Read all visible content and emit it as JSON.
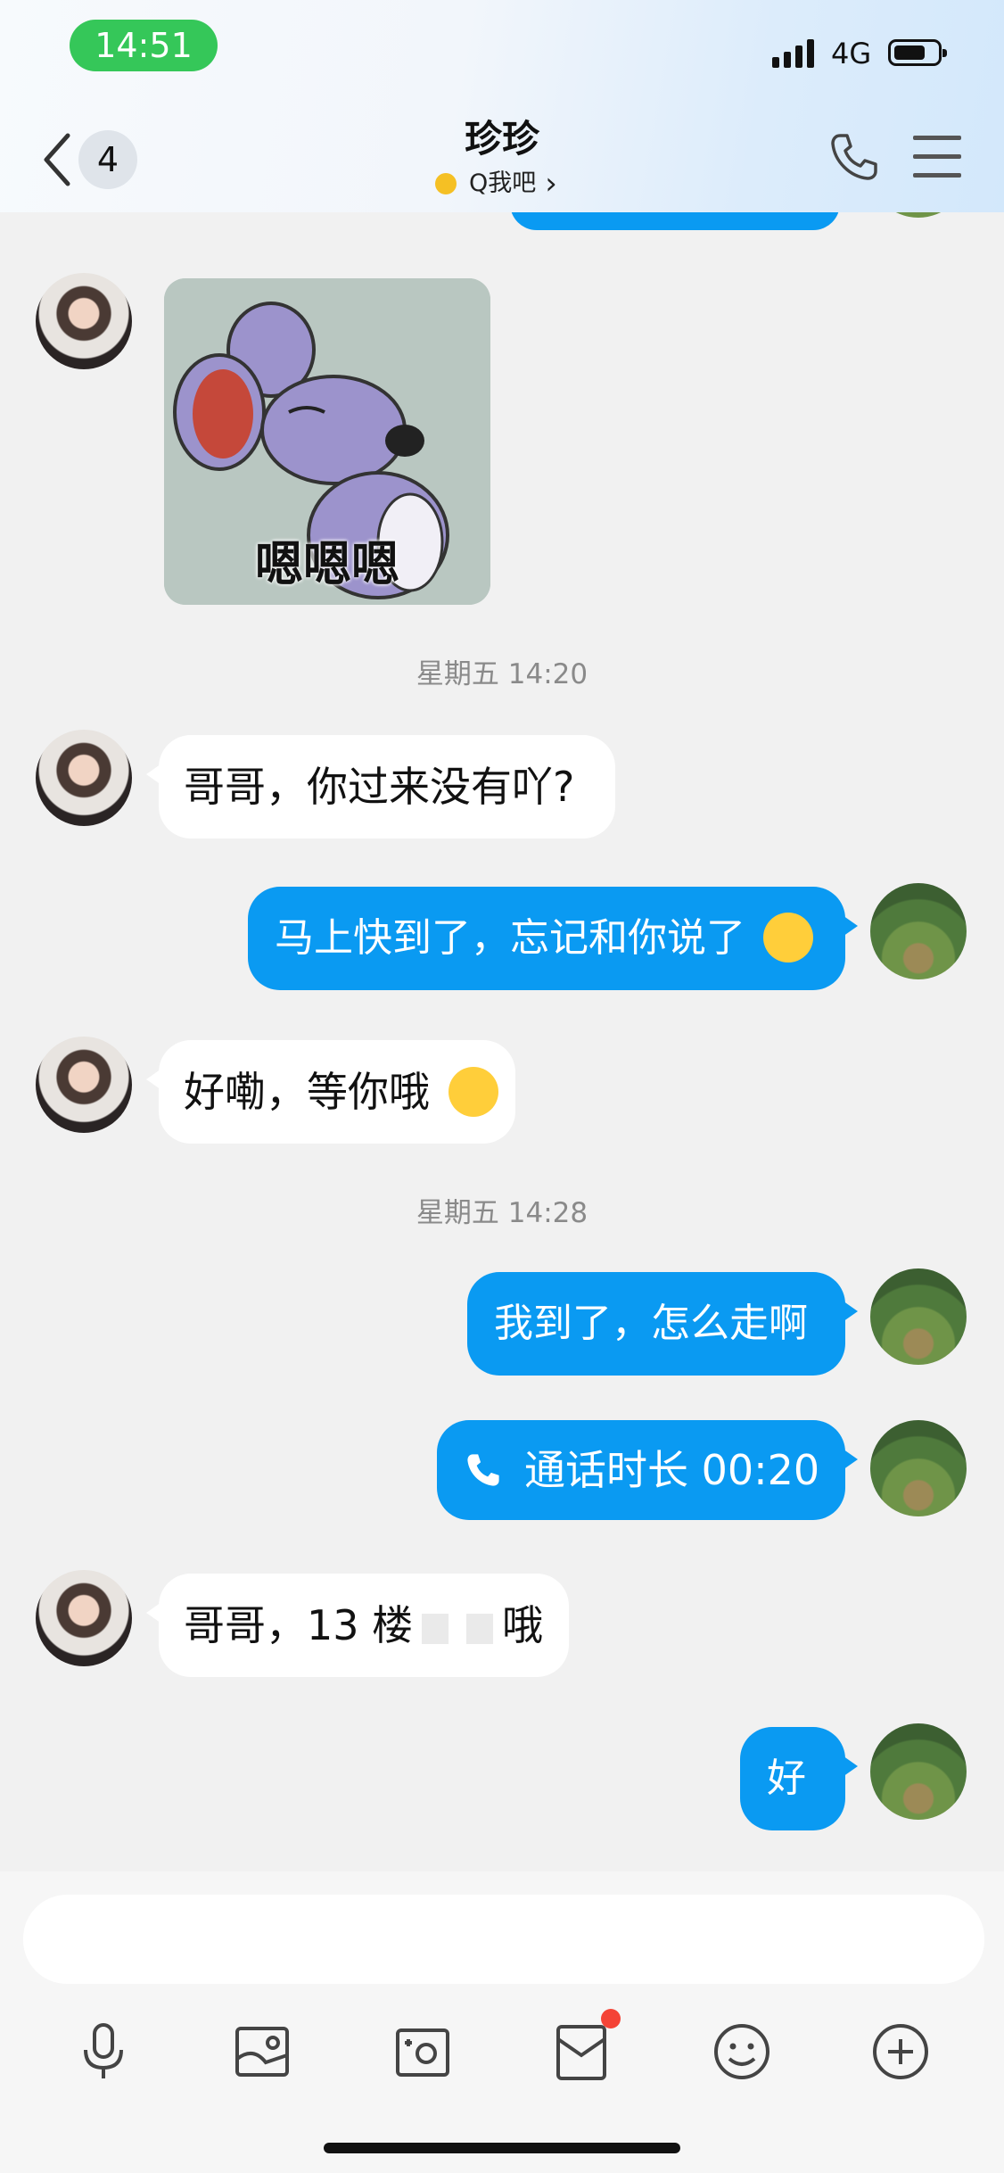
{
  "status_bar": {
    "time": "14:51",
    "network": "4G"
  },
  "header": {
    "unread_count": "4",
    "title": "珍珍",
    "subtitle": "Q我吧",
    "subtitle_chevron": "›"
  },
  "messages": [
    {
      "type": "sticker",
      "side": "in",
      "caption": "嗯嗯嗯"
    },
    {
      "type": "timestamp",
      "text": "星期五 14:20"
    },
    {
      "type": "text",
      "side": "in",
      "text": "哥哥，你过来没有吖?"
    },
    {
      "type": "text",
      "side": "out",
      "text": "马上快到了，忘记和你说了",
      "emoji": "face-with-tears-of-joy"
    },
    {
      "type": "text",
      "side": "in",
      "text": "好嘞，等你哦",
      "emoji": "relieved-face"
    },
    {
      "type": "timestamp",
      "text": "星期五 14:28"
    },
    {
      "type": "text",
      "side": "out",
      "text": "我到了，怎么走啊"
    },
    {
      "type": "call",
      "side": "out",
      "text": "通话时长 00:20"
    },
    {
      "type": "text",
      "side": "in",
      "text_before": "哥哥，13 楼",
      "text_after": "哦"
    },
    {
      "type": "text",
      "side": "out",
      "text": "好"
    }
  ],
  "toolbar": {
    "items": [
      "microphone-icon",
      "image-icon",
      "camera-icon",
      "red-packet-icon",
      "emoji-icon",
      "plus-icon"
    ]
  },
  "colors": {
    "status_pill": "#35c759",
    "out_bubble": "#0a9af2",
    "in_bubble": "#ffffff",
    "background": "#f1f1f1",
    "badge_dot": "#f44336"
  }
}
